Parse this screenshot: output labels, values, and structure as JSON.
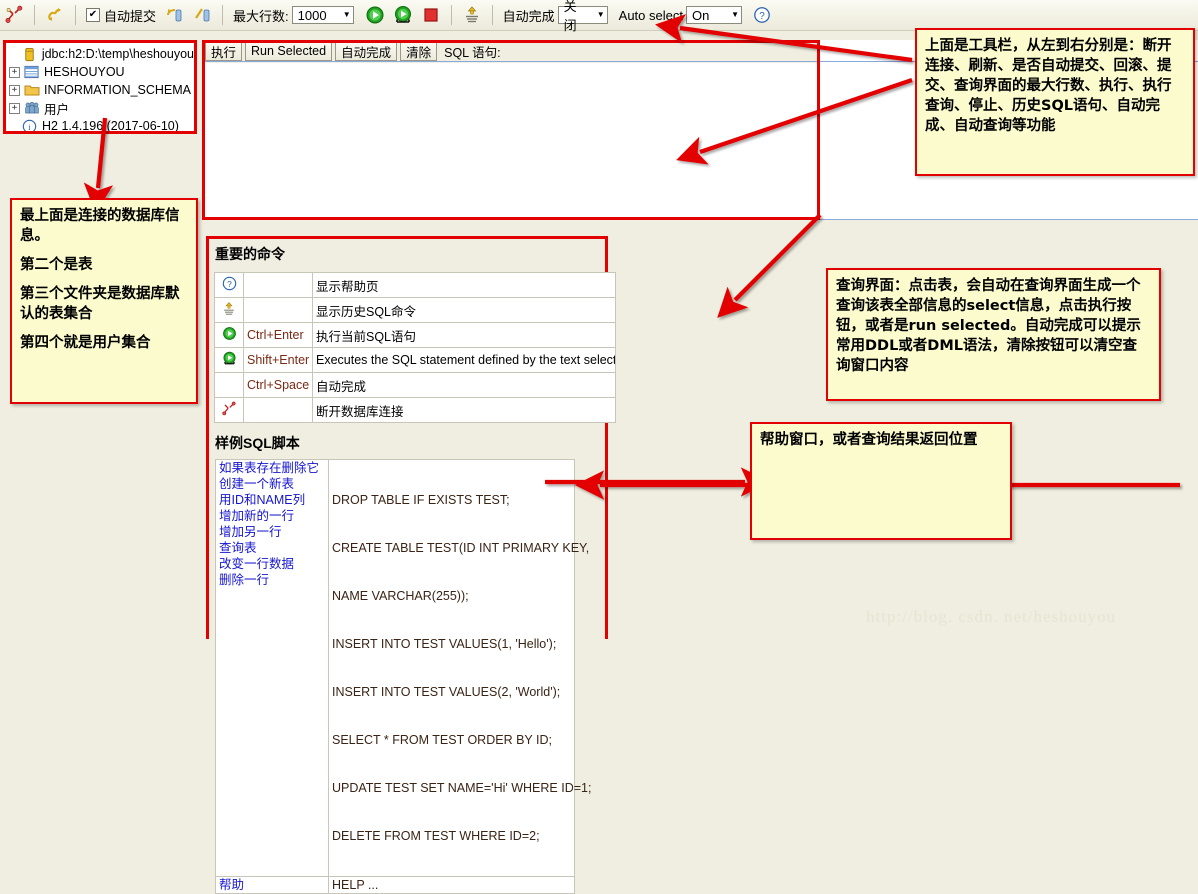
{
  "toolbar": {
    "disconnect_icon": "disconnect-icon",
    "refresh_icon": "refresh-icon",
    "autocommit_checkbox_label": "自动提交",
    "autocommit_checked": "✔",
    "rollback_icon": "rollback-icon",
    "commit_icon": "commit-icon",
    "max_rows_label": "最大行数:",
    "max_rows_value": "1000",
    "run_icon": "run-icon",
    "run_selected_icon": "run-selected-icon",
    "stop_icon": "stop-icon",
    "history_icon": "history-icon",
    "autocomplete_label": "自动完成",
    "autocomplete_value": "关闭",
    "auto_select_label": "Auto select",
    "auto_select_value": "On",
    "help_icon": "help-icon",
    "dropdown_arrow": "▼"
  },
  "tree": {
    "items": [
      {
        "label": "jdbc:h2:D:\\temp\\heshouyou",
        "icon": "database-icon",
        "expander": ""
      },
      {
        "label": "HESHOUYOU",
        "icon": "table-icon",
        "expander": "+"
      },
      {
        "label": "INFORMATION_SCHEMA",
        "icon": "folder-icon",
        "expander": "+"
      },
      {
        "label": "用户",
        "icon": "users-icon",
        "expander": "+"
      },
      {
        "label": "H2 1.4.196 (2017-06-10)",
        "icon": "info-icon",
        "expander": ""
      }
    ]
  },
  "query_bar": {
    "run_label": "执行",
    "run_selected_label": "Run Selected",
    "autocomplete_label": "自动完成",
    "clear_label": "清除",
    "sql_label": "SQL 语句:",
    "editor_value": ""
  },
  "help": {
    "commands_title": "重要的命令",
    "commands": [
      {
        "icon": "help-icon",
        "key": "",
        "desc": "显示帮助页"
      },
      {
        "icon": "history-icon",
        "key": "",
        "desc": "显示历史SQL命令"
      },
      {
        "icon": "run-icon",
        "key": "Ctrl+Enter",
        "desc": "执行当前SQL语句"
      },
      {
        "icon": "run-selected-icon",
        "key": "Shift+Enter",
        "desc": "Executes the SQL statement defined by the text selection"
      },
      {
        "icon": "",
        "key": "Ctrl+Space",
        "desc": "自动完成"
      },
      {
        "icon": "disconnect-icon",
        "key": "",
        "desc": "断开数据库连接"
      }
    ],
    "sample_title": "样例SQL脚本",
    "sample_rows": [
      {
        "note": "如果表存在删除它",
        "sql": "DROP TABLE IF EXISTS TEST;"
      },
      {
        "note": "创建一个新表",
        "sql": "CREATE TABLE TEST(ID INT PRIMARY KEY,"
      },
      {
        "note": " 用ID和NAME列",
        "sql": "  NAME VARCHAR(255));"
      },
      {
        "note": "增加新的一行",
        "sql": "INSERT INTO TEST VALUES(1, 'Hello');"
      },
      {
        "note": "增加另一行",
        "sql": "INSERT INTO TEST VALUES(2, 'World');"
      },
      {
        "note": "查询表",
        "sql": "SELECT * FROM TEST ORDER BY ID;"
      },
      {
        "note": "改变一行数据",
        "sql": "UPDATE TEST SET NAME='Hi' WHERE ID=1;"
      },
      {
        "note": "删除一行",
        "sql": "DELETE FROM TEST WHERE ID=2;"
      },
      {
        "note": "帮助",
        "sql": "HELP ..."
      }
    ]
  },
  "callouts": {
    "toolbar": "上面是工具栏，从左到右分别是：断开连接、刷新、是否自动提交、回滚、提交、查询界面的最大行数、执行、执行查询、停止、历史SQL语句、自动完成、自动查询等功能",
    "tree_p1": "最上面是连接的数据库信息。",
    "tree_p2": "第二个是表",
    "tree_p3": "第三个文件夹是数据库默认的表集合",
    "tree_p4": "第四个就是用户集合",
    "query": "查询界面：点击表，会自动在查询界面生成一个查询该表全部信息的select信息，点击执行按钮，或者是run selected。自动完成可以提示常用DDL或者DML语法，清除按钮可以清空查询窗口内容",
    "help": "帮助窗口，或者查询结果返回位置"
  },
  "watermark": "http://blog. csdn. net/heshouyou",
  "colors": {
    "annotation_border": "#e30000",
    "annotation_bg": "#fbfbcd",
    "app_bg": "#efeee0"
  }
}
